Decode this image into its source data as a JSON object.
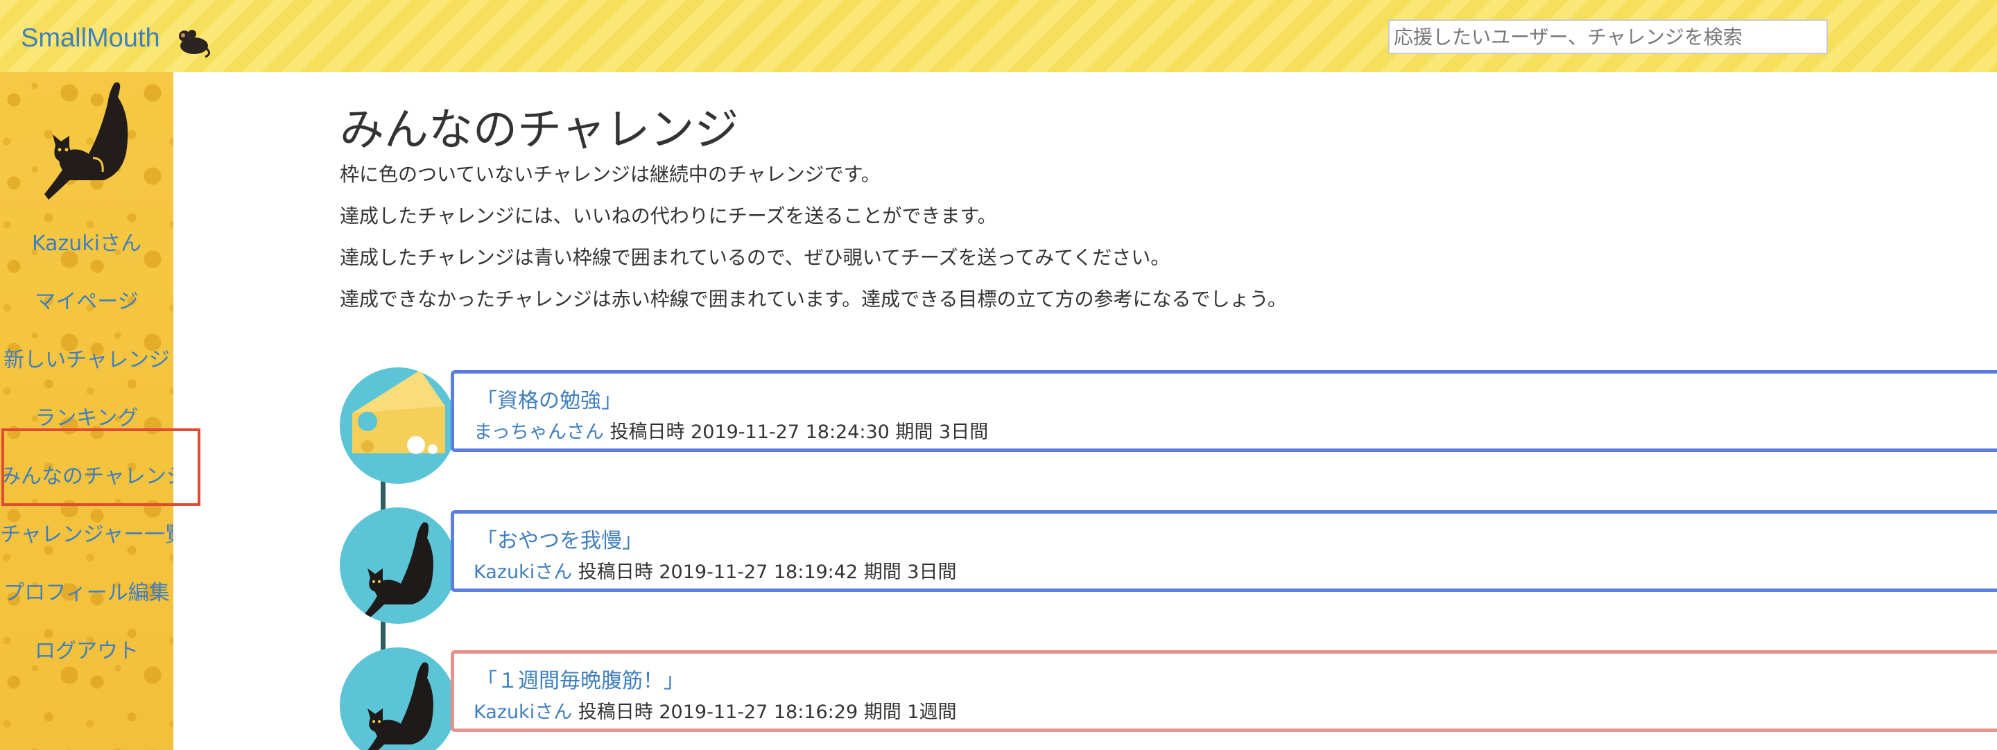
{
  "header": {
    "brand": "SmallMouth",
    "brand_icon": "mouse-icon",
    "search_placeholder": "応援したいユーザー、チャレンジを検索"
  },
  "sidebar": {
    "logo_icon": "stretching-cat-icon",
    "items": [
      {
        "label": "Kazukiさん"
      },
      {
        "label": "マイページ"
      },
      {
        "label": "新しいチャレンジ"
      },
      {
        "label": "ランキング"
      },
      {
        "label": "みんなのチャレンジ",
        "active": true
      },
      {
        "label": "チャレンジャー一覧"
      },
      {
        "label": "プロフィール編集"
      },
      {
        "label": "ログアウト"
      }
    ]
  },
  "main": {
    "title": "みんなのチャレンジ",
    "descriptions": [
      "枠に色のついていないチャレンジは継続中のチャレンジです。",
      "達成したチャレンジには、いいねの代わりにチーズを送ることができます。",
      "達成したチャレンジは青い枠線で囲まれているので、ぜひ覗いてチーズを送ってみてください。",
      "達成できなかったチャレンジは赤い枠線で囲まれています。達成できる目標の立て方の参考になるでしょう。"
    ],
    "challenges": [
      {
        "title": "「資格の勉強」",
        "user": "まっちゃんさん",
        "meta": "投稿日時 2019-11-27 18:24:30 期間 3日間",
        "status": "achieved",
        "border_color": "#5a7fe0",
        "avatar_icon": "cheese-icon"
      },
      {
        "title": "「おやつを我慢」",
        "user": "Kazukiさん",
        "meta": "投稿日時 2019-11-27 18:19:42 期間 3日間",
        "status": "achieved",
        "border_color": "#5a7fe0",
        "avatar_icon": "cat-icon"
      },
      {
        "title": "「１週間毎晩腹筋！」",
        "user": "Kazukiさん",
        "meta": "投稿日時 2019-11-27 18:16:29 期間 1週間",
        "status": "failed",
        "border_color": "#e4938c",
        "avatar_icon": "cat-icon"
      }
    ]
  },
  "colors": {
    "link": "#3f7fbf",
    "header_stripe": "#fbe776",
    "sidebar_cheese": "#f6c843",
    "avatar_bg": "#5bc4d6",
    "achieved_border": "#5a7fe0",
    "failed_border": "#e4938c",
    "active_highlight": "#e04a35"
  }
}
